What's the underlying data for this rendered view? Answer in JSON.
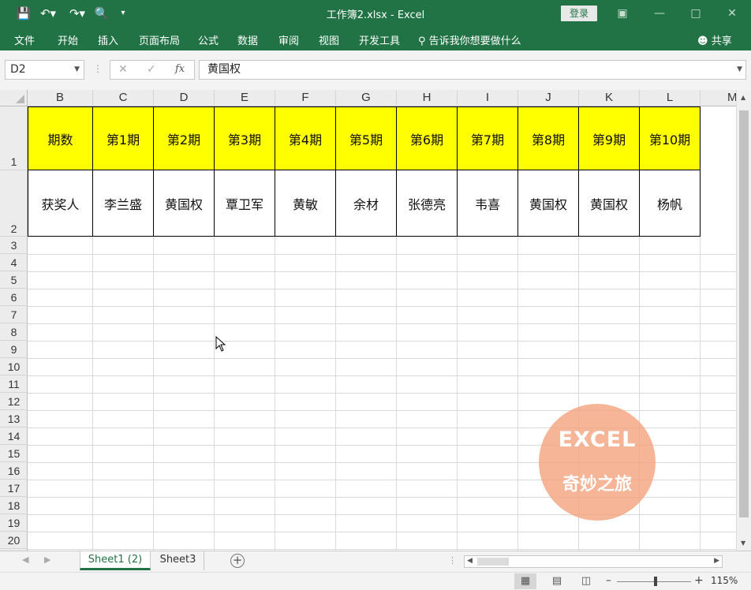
{
  "window": {
    "title": "工作簿2.xlsx  -  Excel",
    "login_label": "登录"
  },
  "ribbon": {
    "tabs": [
      "文件",
      "开始",
      "插入",
      "页面布局",
      "公式",
      "数据",
      "审阅",
      "视图",
      "开发工具"
    ],
    "tell_me": "告诉我你想要做什么",
    "share": "共享"
  },
  "formula_bar": {
    "name_box": "D2",
    "fx_label": "fx",
    "content": "黄国权"
  },
  "columns": [
    "B",
    "C",
    "D",
    "E",
    "F",
    "G",
    "H",
    "I",
    "J",
    "K",
    "L",
    "M"
  ],
  "rows": [
    "1",
    "2",
    "3",
    "4",
    "5",
    "6",
    "7",
    "8",
    "9",
    "10",
    "11",
    "12",
    "13",
    "14",
    "15",
    "16",
    "17",
    "18",
    "19",
    "20"
  ],
  "table": {
    "row1": [
      "期数",
      "第1期",
      "第2期",
      "第3期",
      "第4期",
      "第5期",
      "第6期",
      "第7期",
      "第8期",
      "第9期",
      "第10期"
    ],
    "row2": [
      "获奖人",
      "李兰盛",
      "黄国权",
      "覃卫军",
      "黄敏",
      "余材",
      "张德亮",
      "韦喜",
      "黄国权",
      "黄国权",
      "杨帆"
    ],
    "header_color": "#ffff00"
  },
  "watermark": {
    "line1": "EXCEL",
    "line2": "奇妙之旅"
  },
  "sheets": {
    "tabs": [
      "Sheet1 (2)",
      "Sheet3"
    ],
    "active": "Sheet1 (2)"
  },
  "status": {
    "zoom": "115%"
  },
  "colors": {
    "excel_green": "#217346"
  }
}
